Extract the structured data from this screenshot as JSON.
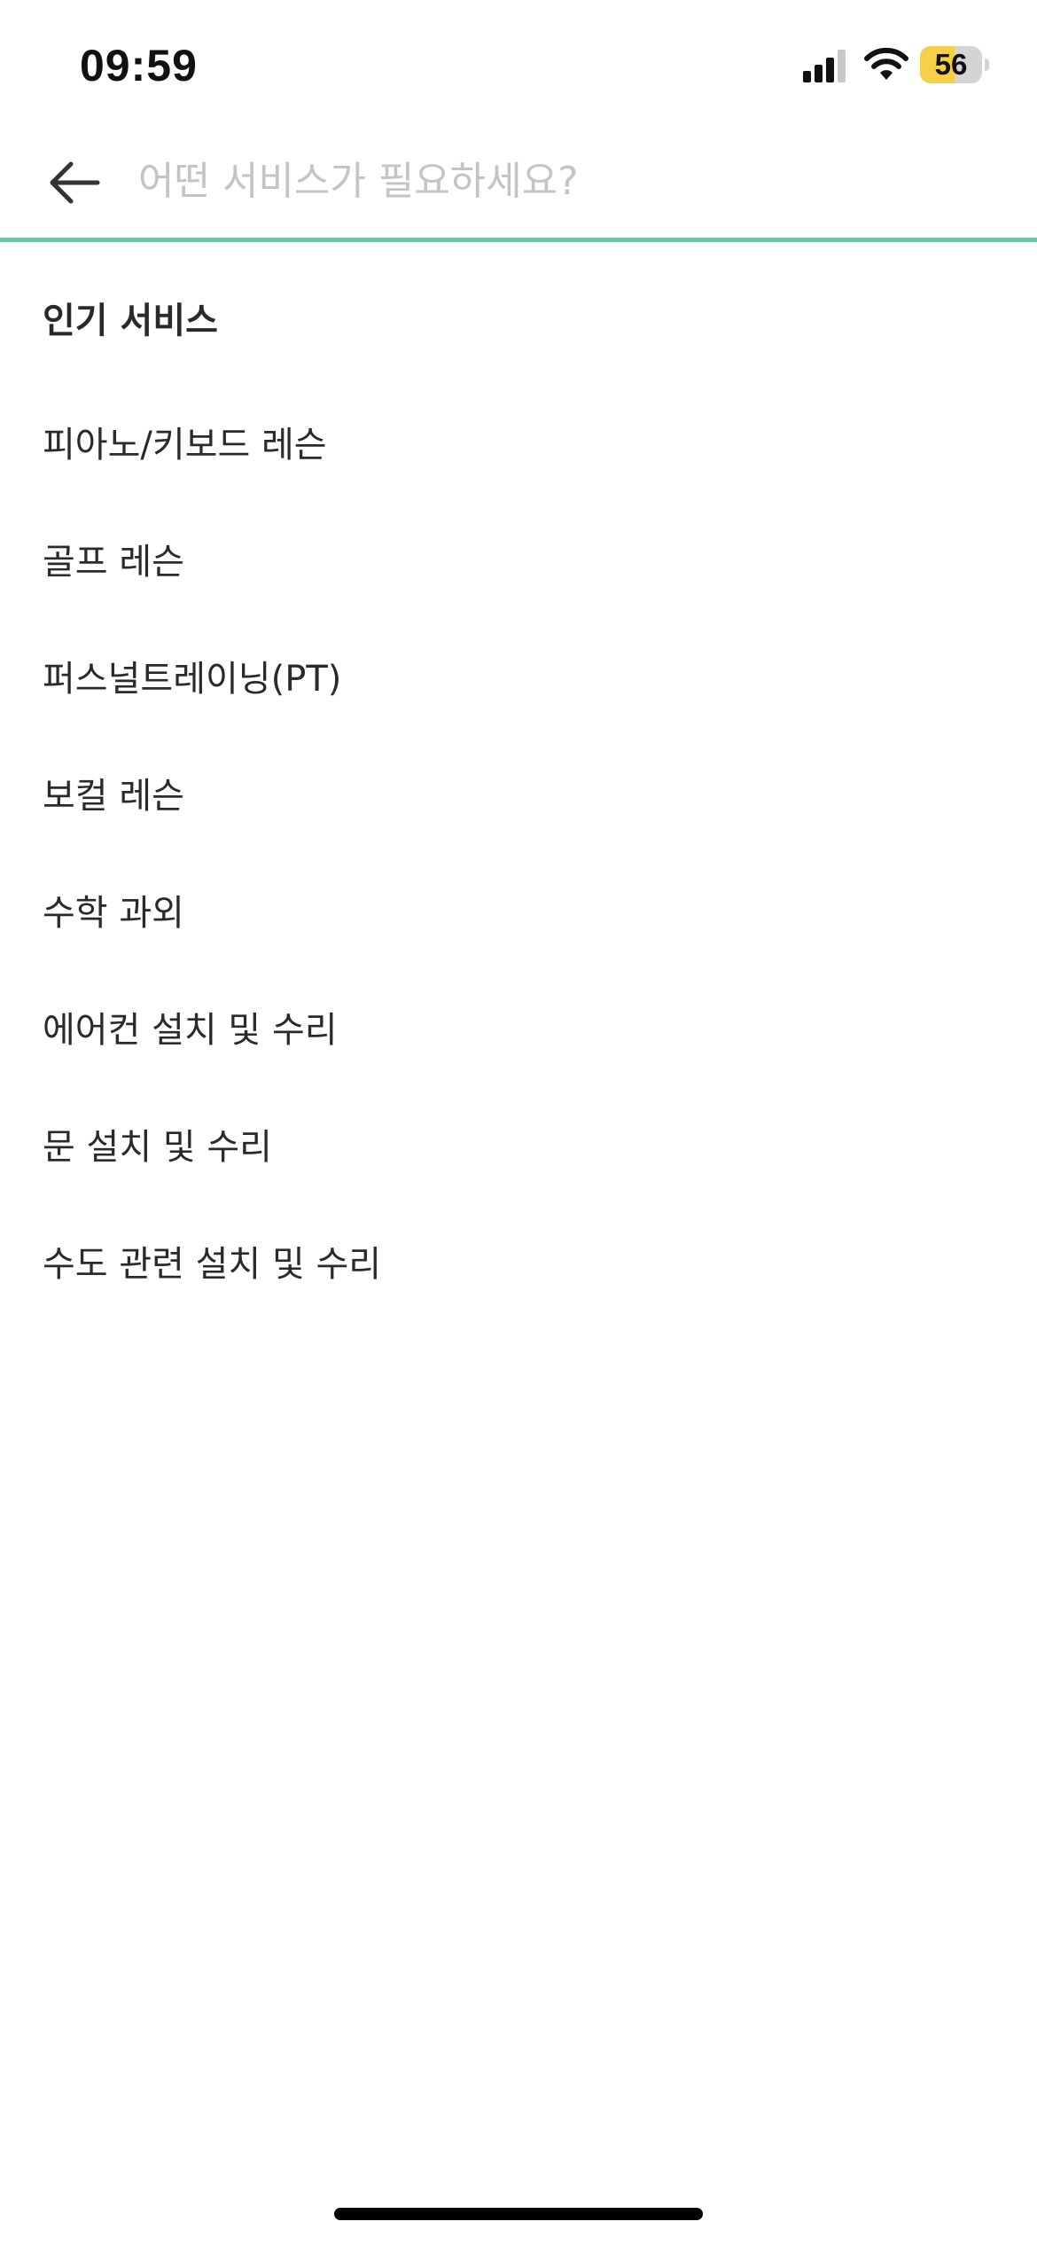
{
  "status_bar": {
    "time": "09:59",
    "battery_level": "56",
    "battery_fraction": 0.56,
    "battery_fill_color": "#f6cf46"
  },
  "search": {
    "placeholder": "어떤 서비스가 필요하세요?",
    "value": "",
    "accent_color": "#6fc3a9",
    "back_icon": "arrow-left-icon"
  },
  "popular": {
    "title": "인기 서비스",
    "items": [
      {
        "label": "피아노/키보드 레슨"
      },
      {
        "label": "골프 레슨"
      },
      {
        "label": "퍼스널트레이닝(PT)"
      },
      {
        "label": "보컬 레슨"
      },
      {
        "label": "수학 과외"
      },
      {
        "label": "에어컨 설치 및 수리"
      },
      {
        "label": "문 설치 및 수리"
      },
      {
        "label": "수도 관련 설치 및 수리"
      }
    ]
  }
}
